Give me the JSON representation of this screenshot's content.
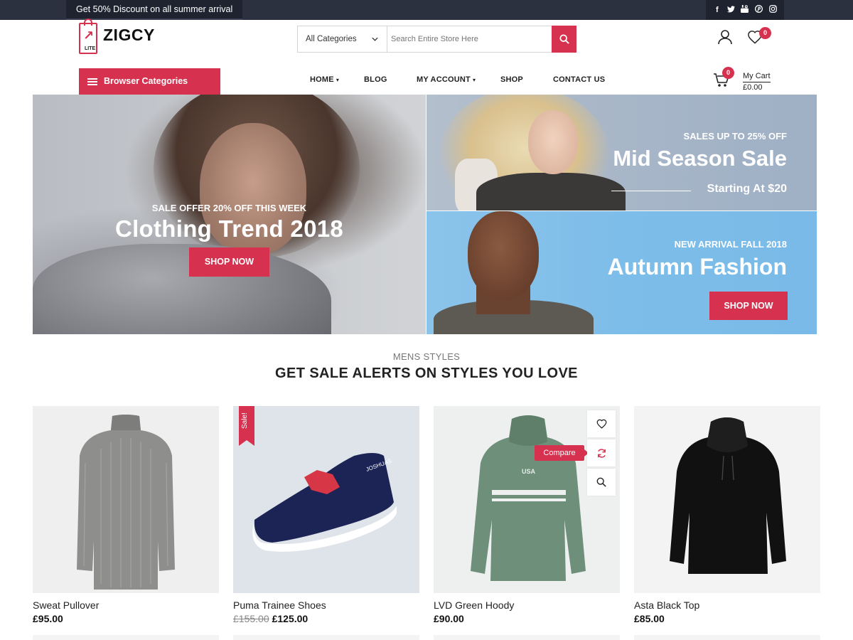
{
  "topbar": {
    "promo": "Get 50% Discount on all summer arrival",
    "social_icons": [
      "facebook-icon",
      "twitter-icon",
      "youtube-icon",
      "pinterest-icon",
      "instagram-icon"
    ]
  },
  "header": {
    "logo_text": "ZIGCY",
    "logo_sub": "LITE",
    "search": {
      "category": "All Categories",
      "placeholder": "Search Entire Store Here"
    },
    "wishlist_count": "0",
    "cart_count": "0",
    "cart_label": "My Cart",
    "cart_total": "£0.00"
  },
  "nav": {
    "browse_label": "Browser Categories",
    "items": [
      {
        "label": "HOME"
      },
      {
        "label": "BLOG"
      },
      {
        "label": "MY ACCOUNT"
      },
      {
        "label": "SHOP"
      },
      {
        "label": "CONTACT US"
      }
    ]
  },
  "banners": {
    "left": {
      "small": "SALE OFFER 20% OFF THIS WEEK",
      "title": "Clothing Trend 2018",
      "button": "SHOP NOW"
    },
    "top_right": {
      "small": "SALES UP TO 25% OFF",
      "title": "Mid Season Sale",
      "sub": "Starting At $20"
    },
    "bottom_right": {
      "small": "NEW ARRIVAL FALL 2018",
      "title": "Autumn Fashion",
      "button": "SHOP NOW"
    }
  },
  "section": {
    "subtitle": "MENS STYLES",
    "title": "GET SALE ALERTS ON STYLES YOU LOVE"
  },
  "products": [
    {
      "name": "Sweat Pullover",
      "price": "£95.00"
    },
    {
      "name": "Puma Trainee Shoes",
      "old_price": "£155.00",
      "price": "£125.00",
      "badge": "Sale!"
    },
    {
      "name": "LVD Green Hoody",
      "price": "£90.00",
      "tooltip": "Compare",
      "print": "USA"
    },
    {
      "name": "Asta Black Top",
      "price": "£85.00"
    }
  ],
  "colors": {
    "accent": "#d6324f",
    "topbar": "#2c3140"
  }
}
